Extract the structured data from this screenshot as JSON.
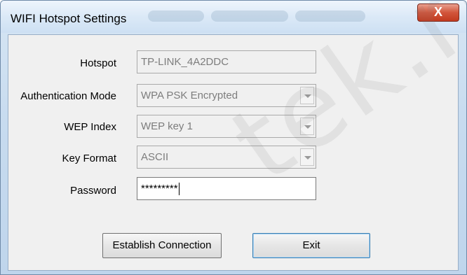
{
  "window": {
    "title": "WIFI Hotspot Settings",
    "close_glyph": "X"
  },
  "form": {
    "hotspot": {
      "label": "Hotspot",
      "value": "TP-LINK_4A2DDC"
    },
    "auth_mode": {
      "label": "Authentication Mode",
      "value": "WPA PSK Encrypted"
    },
    "wep_index": {
      "label": "WEP Index",
      "value": "WEP key 1"
    },
    "key_format": {
      "label": "Key Format",
      "value": "ASCII"
    },
    "password": {
      "label": "Password",
      "value": "*********"
    }
  },
  "buttons": {
    "establish": "Establish  Connection",
    "exit": "Exit"
  },
  "watermark": "tek.ru",
  "colors": {
    "close_button": "#d2553b",
    "dialog_bg": "#f0f0f0",
    "frame": "#c7dbef"
  }
}
